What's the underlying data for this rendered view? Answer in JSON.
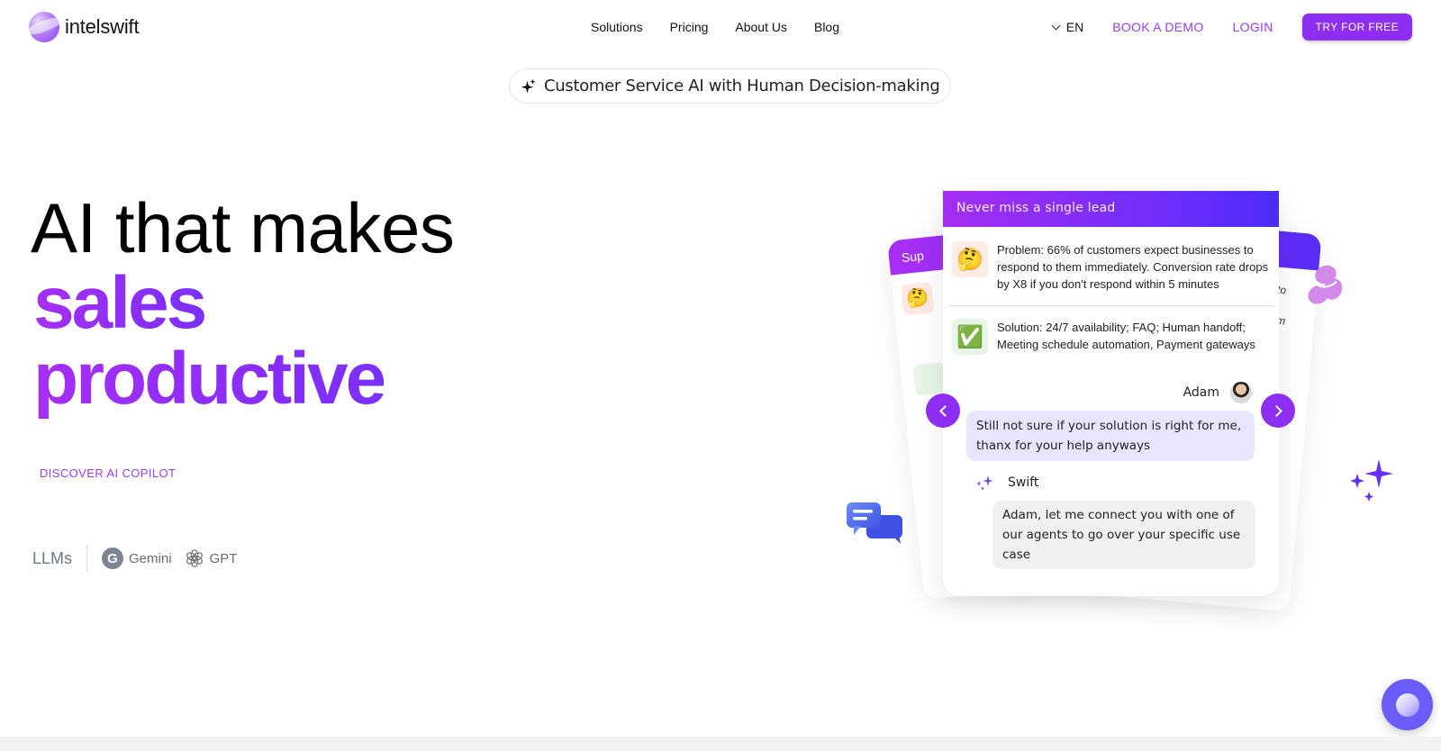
{
  "header": {
    "brand": "intelswift",
    "nav": [
      "Solutions",
      "Pricing",
      "About Us",
      "Blog"
    ],
    "language": "EN",
    "book_demo": "BOOK A DEMO",
    "login": "LOGIN",
    "try_free": "TRY FOR FREE"
  },
  "badge": {
    "icon": "sparkle-icon",
    "text": "Customer Service AI with Human Decision-making"
  },
  "hero": {
    "line1": "AI that makes",
    "line2": "sales",
    "line3": "productive",
    "cta": "DISCOVER AI COPILOT"
  },
  "llms": {
    "label": "LLMs",
    "items": [
      {
        "icon": "gemini-g-icon",
        "name": "Gemini",
        "glyph": "G"
      },
      {
        "icon": "openai-icon",
        "name": "GPT"
      }
    ]
  },
  "carousel": {
    "back_left": {
      "title_fragment": "Sup"
    },
    "back_right": {
      "text1": "to",
      "text2": "em"
    },
    "card": {
      "title": "Never miss a single lead",
      "problem": {
        "emoji": "🤔",
        "text": "Problem: 66% of customers expect businesses to respond to them immediately. Conversion rate drops by X8 if you don't respond within 5 minutes"
      },
      "solution": {
        "emoji": "✅",
        "text": "Solution: 24/7 availability; FAQ; Human handoff; Meeting schedule automation, Payment gateways"
      },
      "user_name": "Adam",
      "user_message": "Still not sure if your solution is right for me, thanx for your help anyways",
      "bot_name": "Swift",
      "bot_message": "Adam, let me connect you with one of our agents to go over your specific use case"
    }
  },
  "colors": {
    "accent": "#8f2ef3",
    "link": "#9b3cf7",
    "user_bubble": "#e9e4ff",
    "bot_bubble": "#f0f0f0",
    "fab": "#6a5cf6"
  }
}
